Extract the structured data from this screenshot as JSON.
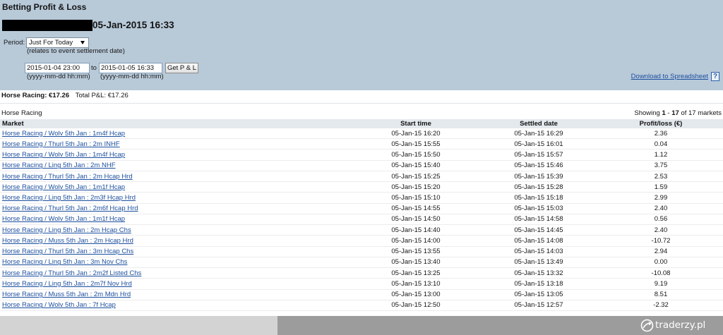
{
  "page": {
    "title": "Betting Profit & Loss",
    "datetime": "05-Jan-2015 16:33"
  },
  "filters": {
    "period_label": "Period:",
    "period_selected": "Just For Today",
    "period_note": "(relates to event settlement date)",
    "from_value": "2015-01-04 23:00",
    "to_label": "to",
    "to_value": "2015-01-05 16:33",
    "get_button": "Get P & L",
    "from_hint": "(yyyy-mm-dd hh:mm)",
    "to_hint": "(yyyy-mm-dd hh:mm)"
  },
  "download": {
    "label": "Download to Spreadsheet",
    "help_glyph": "?"
  },
  "summary": {
    "sport_label": "Horse Racing:",
    "sport_value": "€17.26",
    "total_label": "Total P&L:",
    "total_value": "€17.26"
  },
  "section": {
    "title": "Horse Racing",
    "showing_prefix": "Showing",
    "range_start": "1",
    "range_separator": "-",
    "range_end": "17",
    "of_total": "of 17 markets"
  },
  "table": {
    "columns": {
      "market": "Market",
      "start_time": "Start time",
      "settled_date": "Settled date",
      "profit_loss": "Profit/loss (€)"
    },
    "rows": [
      {
        "market": "Horse Racing / Wolv 5th Jan : 1m4f Hcap",
        "start_time": "05-Jan-15 16:20",
        "settled_date": "05-Jan-15 16:29",
        "profit_loss": "2.36"
      },
      {
        "market": "Horse Racing / Thurl 5th Jan : 2m INHF",
        "start_time": "05-Jan-15 15:55",
        "settled_date": "05-Jan-15 16:01",
        "profit_loss": "0.04"
      },
      {
        "market": "Horse Racing / Wolv 5th Jan : 1m4f Hcap",
        "start_time": "05-Jan-15 15:50",
        "settled_date": "05-Jan-15 15:57",
        "profit_loss": "1.12"
      },
      {
        "market": "Horse Racing / Ling 5th Jan : 2m NHF",
        "start_time": "05-Jan-15 15:40",
        "settled_date": "05-Jan-15 15:46",
        "profit_loss": "3.75"
      },
      {
        "market": "Horse Racing / Thurl 5th Jan : 2m Hcap Hrd",
        "start_time": "05-Jan-15 15:25",
        "settled_date": "05-Jan-15 15:39",
        "profit_loss": "2.53"
      },
      {
        "market": "Horse Racing / Wolv 5th Jan : 1m1f Hcap",
        "start_time": "05-Jan-15 15:20",
        "settled_date": "05-Jan-15 15:28",
        "profit_loss": "1.59"
      },
      {
        "market": "Horse Racing / Ling 5th Jan : 2m3f Hcap Hrd",
        "start_time": "05-Jan-15 15:10",
        "settled_date": "05-Jan-15 15:18",
        "profit_loss": "2.99"
      },
      {
        "market": "Horse Racing / Thurl 5th Jan : 2m6f Hcap Hrd",
        "start_time": "05-Jan-15 14:55",
        "settled_date": "05-Jan-15 15:03",
        "profit_loss": "2.40"
      },
      {
        "market": "Horse Racing / Wolv 5th Jan : 1m1f Hcap",
        "start_time": "05-Jan-15 14:50",
        "settled_date": "05-Jan-15 14:58",
        "profit_loss": "0.56"
      },
      {
        "market": "Horse Racing / Ling 5th Jan : 2m Hcap Chs",
        "start_time": "05-Jan-15 14:40",
        "settled_date": "05-Jan-15 14:45",
        "profit_loss": "2.40"
      },
      {
        "market": "Horse Racing / Muss 5th Jan : 2m Hcap Hrd",
        "start_time": "05-Jan-15 14:00",
        "settled_date": "05-Jan-15 14:08",
        "profit_loss": "-10.72"
      },
      {
        "market": "Horse Racing / Thurl 5th Jan : 3m Hcap Chs",
        "start_time": "05-Jan-15 13:55",
        "settled_date": "05-Jan-15 14:03",
        "profit_loss": "2.94"
      },
      {
        "market": "Horse Racing / Ling 5th Jan : 3m Nov Chs",
        "start_time": "05-Jan-15 13:40",
        "settled_date": "05-Jan-15 13:49",
        "profit_loss": "0.00"
      },
      {
        "market": "Horse Racing / Thurl 5th Jan : 2m2f Listed Chs",
        "start_time": "05-Jan-15 13:25",
        "settled_date": "05-Jan-15 13:32",
        "profit_loss": "-10.08"
      },
      {
        "market": "Horse Racing / Ling 5th Jan : 2m7f Nov Hrd",
        "start_time": "05-Jan-15 13:10",
        "settled_date": "05-Jan-15 13:18",
        "profit_loss": "9.19"
      },
      {
        "market": "Horse Racing / Muss 5th Jan : 2m Mdn Hrd",
        "start_time": "05-Jan-15 13:00",
        "settled_date": "05-Jan-15 13:05",
        "profit_loss": "8.51"
      },
      {
        "market": "Horse Racing / Wolv 5th Jan : 7f Hcap",
        "start_time": "05-Jan-15 12:50",
        "settled_date": "05-Jan-15 12:57",
        "profit_loss": "-2.32"
      }
    ]
  },
  "watermark": {
    "text": "traderzy.pl"
  },
  "icons": {
    "period_dropdown": "chevron-down-icon",
    "help": "help-icon",
    "watermark_logo": "traderzy-logo-icon"
  },
  "colors": {
    "header_background": "#b8c9d8",
    "link": "#1c4f9f",
    "table_header_background": "#e4e9ee"
  }
}
